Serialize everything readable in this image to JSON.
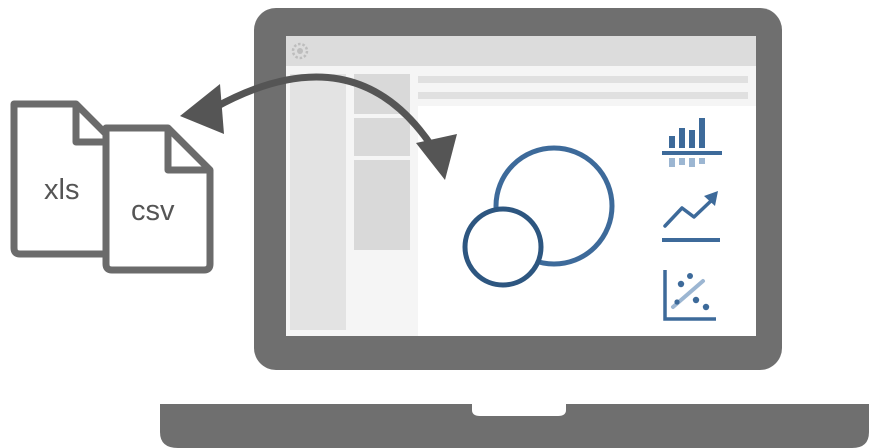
{
  "files": [
    {
      "name": "xls-file",
      "label": "xls"
    },
    {
      "name": "csv-file",
      "label": "csv"
    }
  ],
  "icons": [
    "gear-icon",
    "bar-chart-icon",
    "line-chart-icon",
    "scatter-chart-icon",
    "venn-circles-icon",
    "sync-arrow-icon"
  ],
  "colors": {
    "frame": "#6f6f6f",
    "screen_bg": "#f5f5f5",
    "panel": "#dedede",
    "accent": "#3d6a9a",
    "accent_light": "#9cb6d2"
  }
}
